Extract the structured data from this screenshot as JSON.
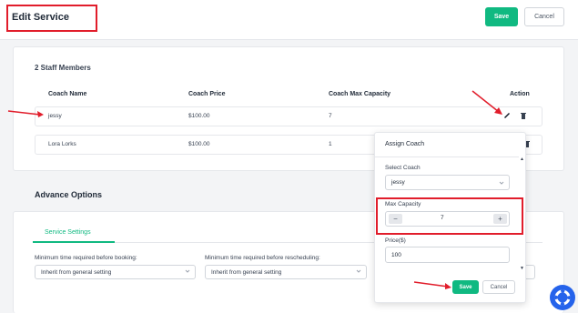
{
  "header": {
    "title": "Edit Service",
    "save_label": "Save",
    "cancel_label": "Cancel"
  },
  "staff": {
    "title": "2 Staff Members",
    "columns": [
      "Coach Name",
      "Coach Price",
      "Coach Max Capacity",
      "Action"
    ],
    "rows": [
      {
        "name": "jessy",
        "price": "$100.00",
        "capacity": "7"
      },
      {
        "name": "Lora Lorks",
        "price": "$100.00",
        "capacity": "1"
      }
    ]
  },
  "advance": {
    "title": "Advance Options",
    "tab_label": "Service Settings",
    "settings": [
      {
        "label": "Minimum time required before booking:",
        "value": "Inherit from general setting"
      },
      {
        "label": "Minimum time required before rescheduling:",
        "value": "Inherit from general setting"
      }
    ]
  },
  "popup": {
    "title": "Assign Coach",
    "select_coach_label": "Select Coach",
    "select_coach_value": "jessy",
    "max_capacity_label": "Max Capacity",
    "max_capacity_value": "7",
    "minus": "−",
    "plus": "+",
    "price_label": "Price($)",
    "price_value": "100",
    "save_label": "Save",
    "cancel_label": "Cancel"
  },
  "colors": {
    "accent": "#10b981",
    "highlight": "#e11d2b",
    "fab": "#2563eb"
  }
}
